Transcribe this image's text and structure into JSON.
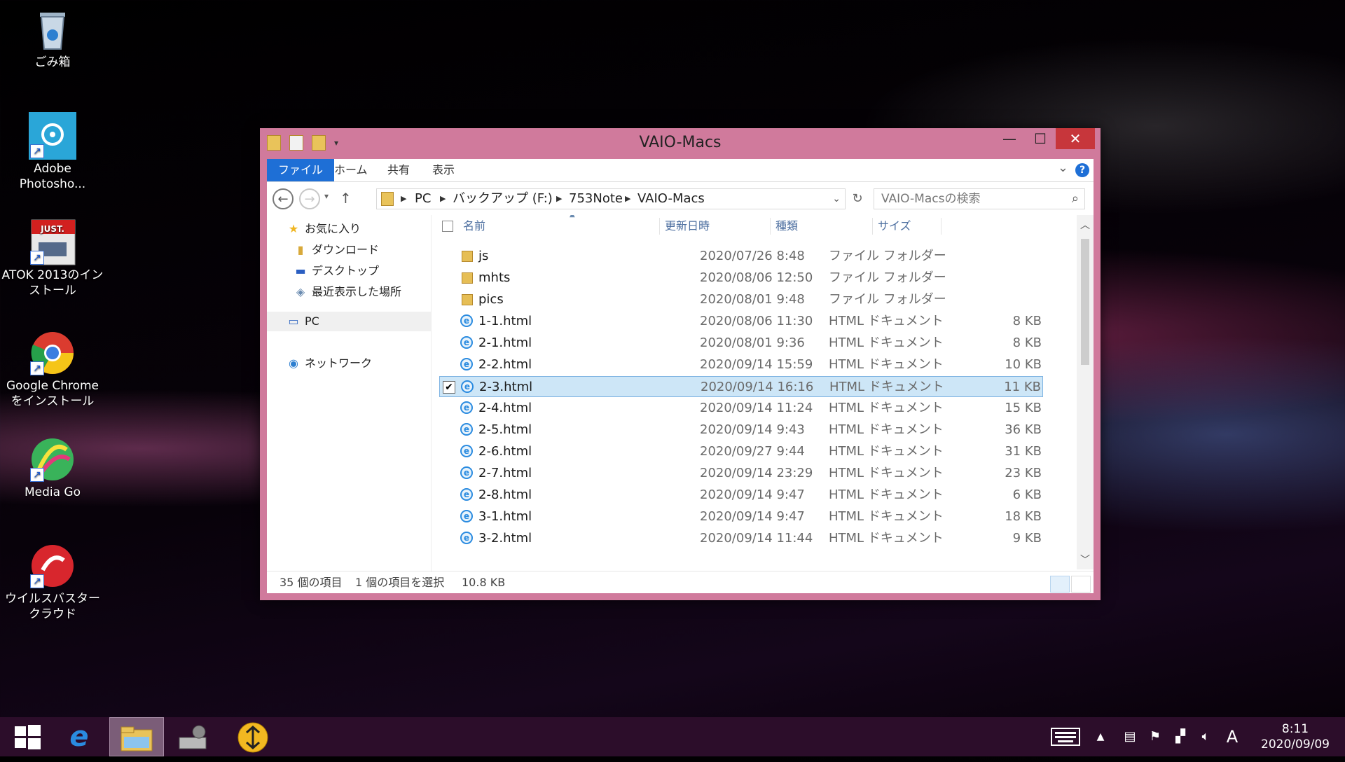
{
  "desktop_icons": [
    {
      "label": "ごみ箱",
      "icon": "recycle-bin-icon"
    },
    {
      "label": "Adobe Photosho...",
      "icon": "photoshop-icon"
    },
    {
      "label": "ATOK 2013のインストール",
      "icon": "atok-icon",
      "badge": "JUST."
    },
    {
      "label": "Google Chrome をインストール",
      "icon": "chrome-icon"
    },
    {
      "label": "Media Go",
      "icon": "media-go-icon"
    },
    {
      "label": "ウイルスバスター クラウド",
      "icon": "virusbuster-icon"
    }
  ],
  "window": {
    "title": "VAIO-Macs",
    "ribbon_tabs": [
      "ファイル",
      "ホーム",
      "共有",
      "表示"
    ],
    "address": [
      "PC",
      "バックアップ (F:)",
      "753Note",
      "VAIO-Macs"
    ],
    "search_placeholder": "VAIO-Macsの検索",
    "nav": {
      "favorites": "お気に入り",
      "downloads": "ダウンロード",
      "desktop": "デスクトップ",
      "recent": "最近表示した場所",
      "pc": "PC",
      "network": "ネットワーク"
    },
    "columns": {
      "name": "名前",
      "date": "更新日時",
      "type": "種類",
      "size": "サイズ"
    },
    "files": [
      {
        "name": "js",
        "date": "2020/07/26 8:48",
        "type": "ファイル フォルダー",
        "size": "",
        "kind": "folder"
      },
      {
        "name": "mhts",
        "date": "2020/08/06 12:50",
        "type": "ファイル フォルダー",
        "size": "",
        "kind": "folder"
      },
      {
        "name": "pics",
        "date": "2020/08/01 9:48",
        "type": "ファイル フォルダー",
        "size": "",
        "kind": "folder"
      },
      {
        "name": "1-1.html",
        "date": "2020/08/06 11:30",
        "type": "HTML ドキュメント",
        "size": "8 KB",
        "kind": "html"
      },
      {
        "name": "2-1.html",
        "date": "2020/08/01 9:36",
        "type": "HTML ドキュメント",
        "size": "8 KB",
        "kind": "html"
      },
      {
        "name": "2-2.html",
        "date": "2020/09/14 15:59",
        "type": "HTML ドキュメント",
        "size": "10 KB",
        "kind": "html"
      },
      {
        "name": "2-3.html",
        "date": "2020/09/14 16:16",
        "type": "HTML ドキュメント",
        "size": "11 KB",
        "kind": "html",
        "selected": true
      },
      {
        "name": "2-4.html",
        "date": "2020/09/14 11:24",
        "type": "HTML ドキュメント",
        "size": "15 KB",
        "kind": "html"
      },
      {
        "name": "2-5.html",
        "date": "2020/09/14 9:43",
        "type": "HTML ドキュメント",
        "size": "36 KB",
        "kind": "html"
      },
      {
        "name": "2-6.html",
        "date": "2020/09/27 9:44",
        "type": "HTML ドキュメント",
        "size": "31 KB",
        "kind": "html"
      },
      {
        "name": "2-7.html",
        "date": "2020/09/14 23:29",
        "type": "HTML ドキュメント",
        "size": "23 KB",
        "kind": "html"
      },
      {
        "name": "2-8.html",
        "date": "2020/09/14 9:47",
        "type": "HTML ドキュメント",
        "size": "6 KB",
        "kind": "html"
      },
      {
        "name": "3-1.html",
        "date": "2020/09/14 9:47",
        "type": "HTML ドキュメント",
        "size": "18 KB",
        "kind": "html"
      },
      {
        "name": "3-2.html",
        "date": "2020/09/14 11:44",
        "type": "HTML ドキュメント",
        "size": "9 KB",
        "kind": "html"
      }
    ],
    "status": {
      "count": "35 個の項目",
      "selected": "1 個の項目を選択",
      "size": "10.8 KB"
    }
  },
  "taskbar": {
    "apps": [
      "start-icon",
      "ie-icon",
      "file-explorer-icon",
      "control-panel-icon",
      "download-icon"
    ],
    "ime": "A",
    "time": "8:11",
    "date": "2020/09/09"
  },
  "colors": {
    "window_frame": "#d07a9c",
    "selection": "#cde6f7",
    "accent": "#1e6fd6",
    "close": "#c7363b"
  }
}
